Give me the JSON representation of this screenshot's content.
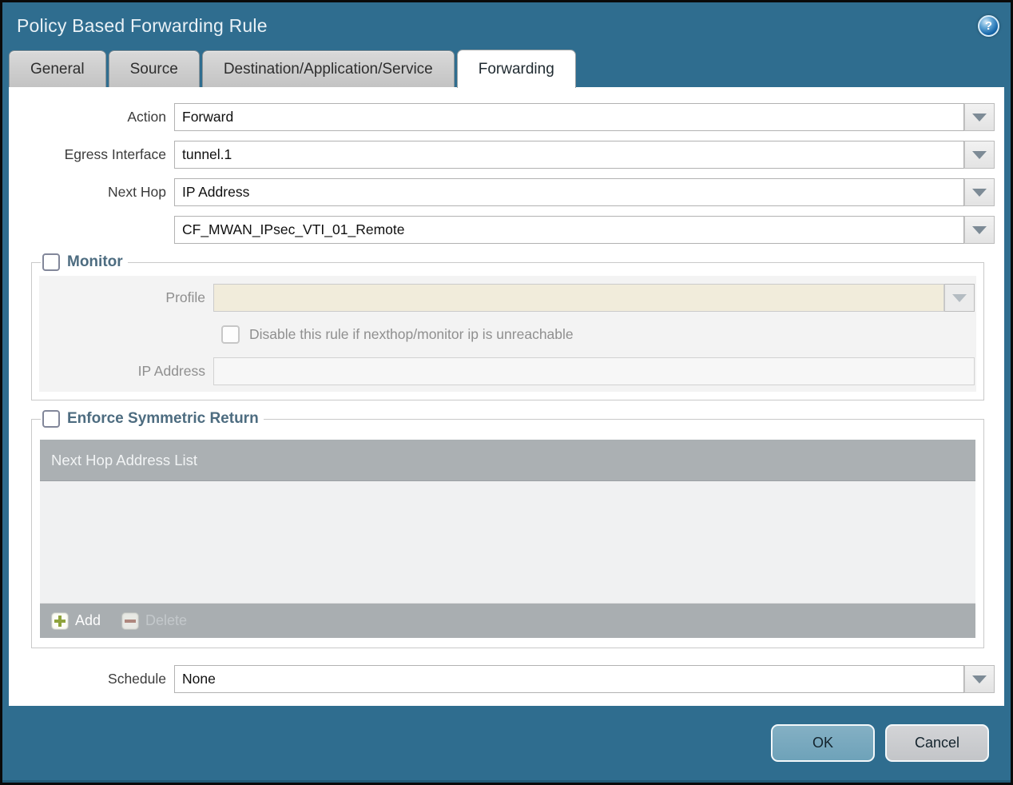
{
  "dialog": {
    "title": "Policy Based Forwarding Rule",
    "help_glyph": "?"
  },
  "tabs": [
    {
      "label": "General",
      "active": false
    },
    {
      "label": "Source",
      "active": false
    },
    {
      "label": "Destination/Application/Service",
      "active": false
    },
    {
      "label": "Forwarding",
      "active": true
    }
  ],
  "form": {
    "action": {
      "label": "Action",
      "value": "Forward"
    },
    "egress_interface": {
      "label": "Egress Interface",
      "value": "tunnel.1"
    },
    "next_hop": {
      "label": "Next Hop",
      "value": "IP Address"
    },
    "next_hop_address": {
      "value": "CF_MWAN_IPsec_VTI_01_Remote"
    },
    "schedule": {
      "label": "Schedule",
      "value": "None"
    }
  },
  "monitor": {
    "legend": "Monitor",
    "checked": false,
    "profile": {
      "label": "Profile",
      "value": ""
    },
    "disable_rule_checkbox": {
      "label": "Disable this rule if nexthop/monitor ip is unreachable",
      "checked": false
    },
    "ip_address": {
      "label": "IP Address",
      "value": ""
    }
  },
  "symmetric_return": {
    "legend": "Enforce Symmetric Return",
    "checked": false,
    "table": {
      "header": "Next Hop Address List",
      "rows": []
    },
    "add_label": "Add",
    "delete_label": "Delete",
    "delete_enabled": false
  },
  "footer": {
    "ok_label": "OK",
    "cancel_label": "Cancel"
  },
  "colors": {
    "chrome_teal": "#2f6d8f",
    "active_tab": "#ffffff",
    "inactive_tab": "#c9c9c9",
    "legend_text": "#4d6c80",
    "table_header": "#abb0b3",
    "table_footer": "#a9aeb1",
    "profile_disabled_bg": "#f1ecdb",
    "ok_button": "#74a6bc",
    "cancel_button": "#c9cbce",
    "add_plus_green": "#8fa33c",
    "delete_minus_red": "#b07a6e"
  }
}
